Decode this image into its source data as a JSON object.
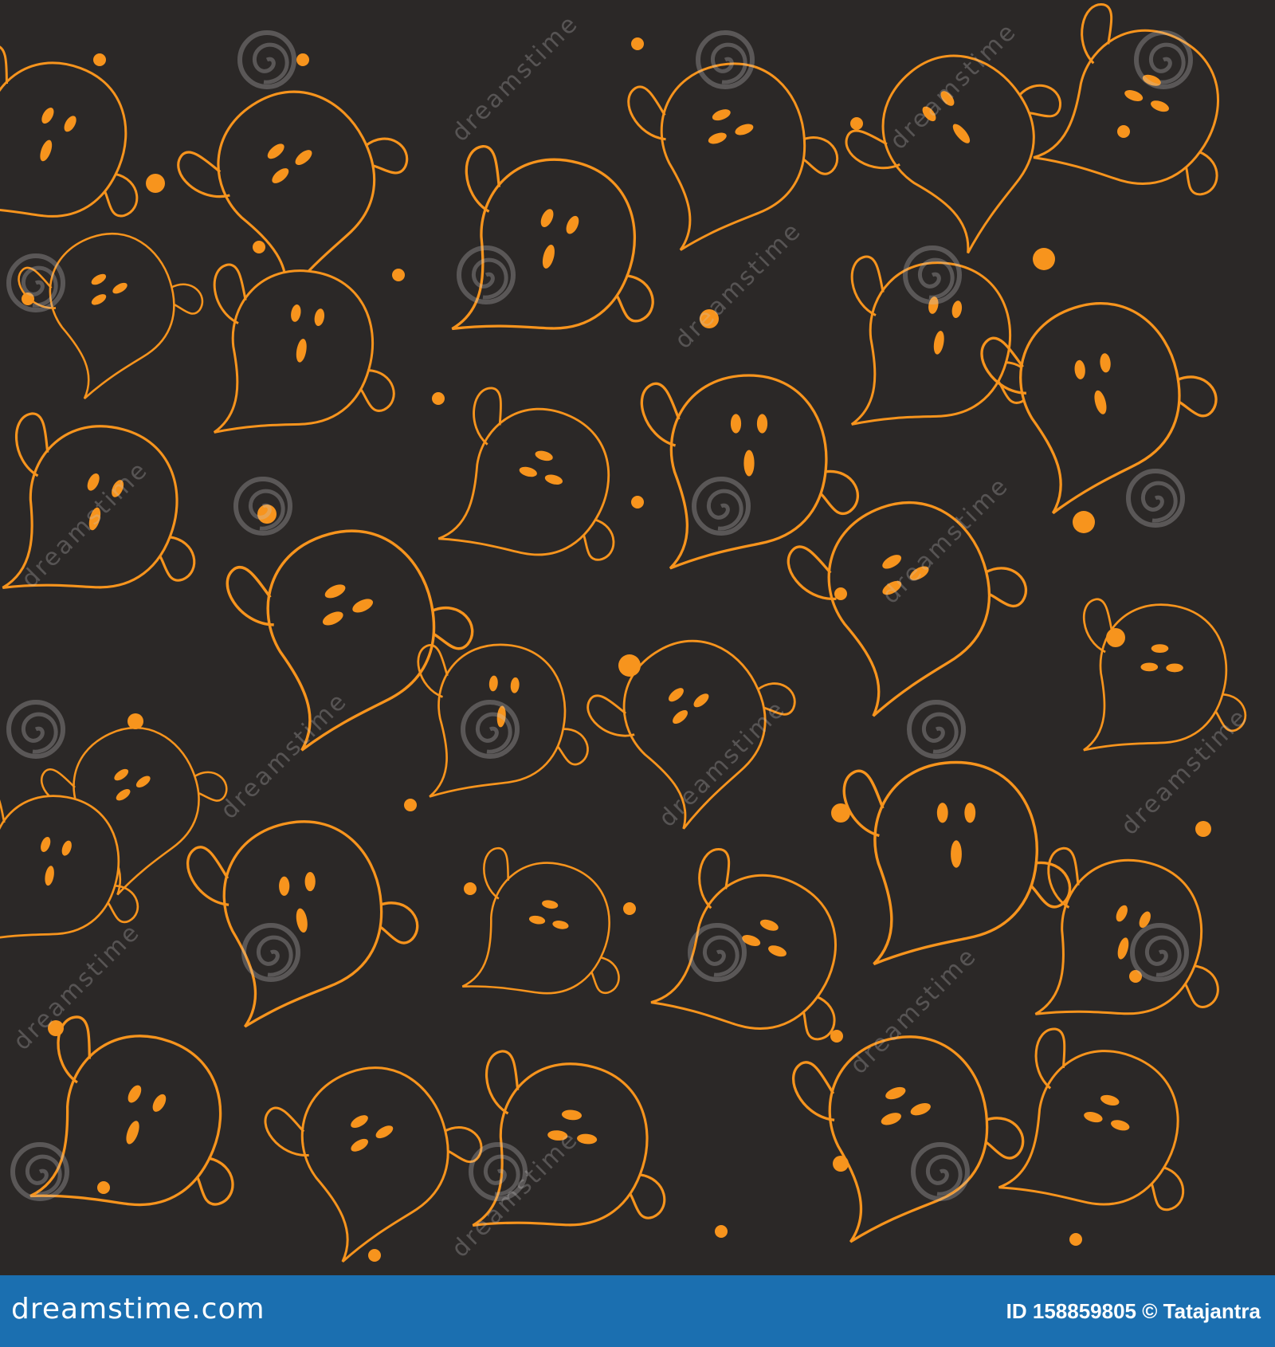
{
  "image": {
    "description_colors": {
      "background": "#2b2827",
      "ghost_outline": "#f7941d",
      "ghost_face": "#f7941d",
      "footer_bar": "#1b6fb0"
    },
    "pattern_subject": "ghost",
    "pattern_icon": "ghost-icon"
  },
  "watermark": {
    "brand": "dreamstime",
    "swirl_icon": "swirl-icon"
  },
  "footer": {
    "logo_text": "dreamstime.com",
    "id_label": "ID",
    "id_value": "158859805",
    "copyright_symbol": "©",
    "author": "Tatajantra"
  }
}
